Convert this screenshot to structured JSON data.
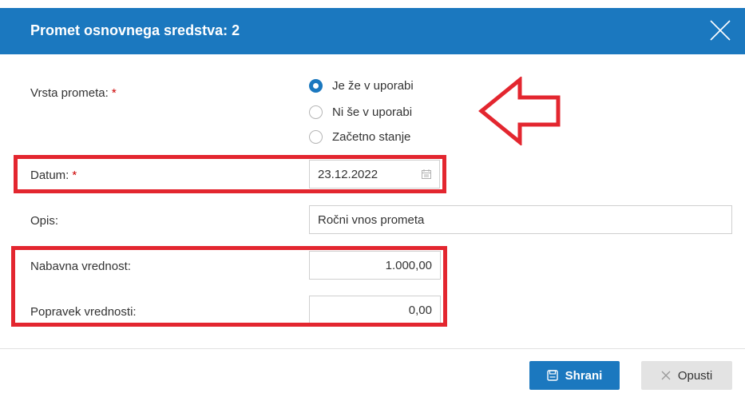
{
  "dialog": {
    "title": "Promet osnovnega sredstva: 2",
    "icons": {
      "close": "close-icon",
      "calendar": "calendar-icon",
      "save": "save-icon",
      "cancel": "x-icon",
      "arrow": "arrow-left-annotation-icon"
    },
    "colors": {
      "header": "#1b78bf",
      "highlight": "#e3262f",
      "required": "#cc0000"
    }
  },
  "form": {
    "transaction_type": {
      "label": "Vrsta prometa:",
      "required": "*",
      "selected": "Je že v uporabi",
      "options": [
        {
          "label": "Je že v uporabi",
          "checked": true
        },
        {
          "label": "Ni še v uporabi",
          "checked": false
        },
        {
          "label": "Začetno stanje",
          "checked": false
        }
      ]
    },
    "date": {
      "label": "Datum:",
      "required": "*",
      "value": "23.12.2022"
    },
    "description": {
      "label": "Opis:",
      "value": "Ročni vnos prometa"
    },
    "purchase_value": {
      "label": "Nabavna vrednost:",
      "value": "1.000,00"
    },
    "value_adjustment": {
      "label": "Popravek vrednosti:",
      "value": "0,00"
    }
  },
  "footer": {
    "save_label": "Shrani",
    "cancel_label": "Opusti"
  }
}
